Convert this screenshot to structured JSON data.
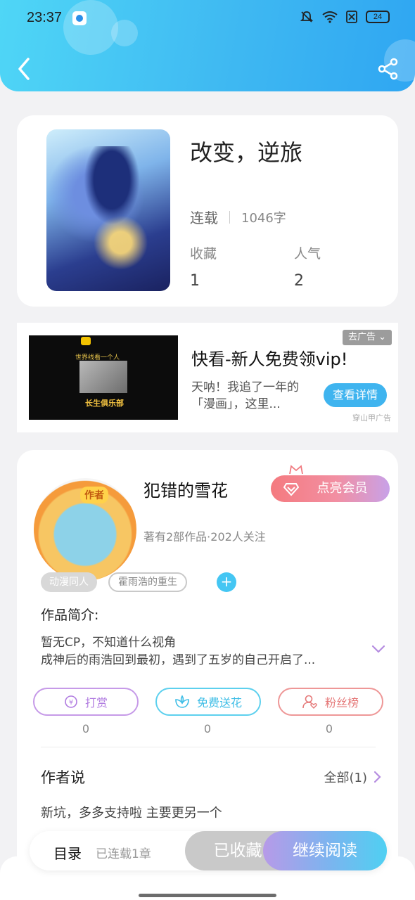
{
  "status_bar": {
    "time": "23:37",
    "battery": "24"
  },
  "book": {
    "title": "改变，逆旅",
    "status": "连载",
    "word_count": "1046字",
    "stats": [
      {
        "label": "收藏",
        "value": "1"
      },
      {
        "label": "人气",
        "value": "2"
      }
    ]
  },
  "ad": {
    "image_line1": "世界线看一个人",
    "image_title": "长生俱乐部",
    "title": "快看-新人免费领vip!",
    "description": "天呐！我追了一年的「漫画」，这里...",
    "button": "查看详情",
    "close_label": "去广告",
    "source": "穿山甲广告"
  },
  "author": {
    "avatar_tag": "作者",
    "name": "犯错的雪花",
    "subtitle": "著有2部作品·202人关注",
    "vip_button": "点亮会员",
    "tags": [
      "动漫同人",
      "霍雨浩的重生"
    ],
    "tag_add": "+",
    "intro_label": "作品简介:",
    "intro_line1": "暂无CP，不知道什么视角",
    "intro_line2": "成神后的雨浩回到最初，遇到了五岁的自己开启了...",
    "actions": [
      {
        "label": "打赏",
        "count": "0"
      },
      {
        "label": "免费送花",
        "count": "0"
      },
      {
        "label": "粉丝榜",
        "count": "0"
      }
    ],
    "say_title": "作者说",
    "say_all": "全部(1)",
    "say_text": "新坑，多多支持啦 主要更另一个"
  },
  "bottom_bar": {
    "toc": "目录",
    "toc_sub": "已连载1章",
    "collected": "已收藏",
    "read": "继续阅读"
  },
  "colors": {
    "header_gradient": [
      "#4fd6f6",
      "#2fa6f2"
    ],
    "accent_cyan": "#3fb4ef",
    "vip_pink": "#f47a7f"
  }
}
